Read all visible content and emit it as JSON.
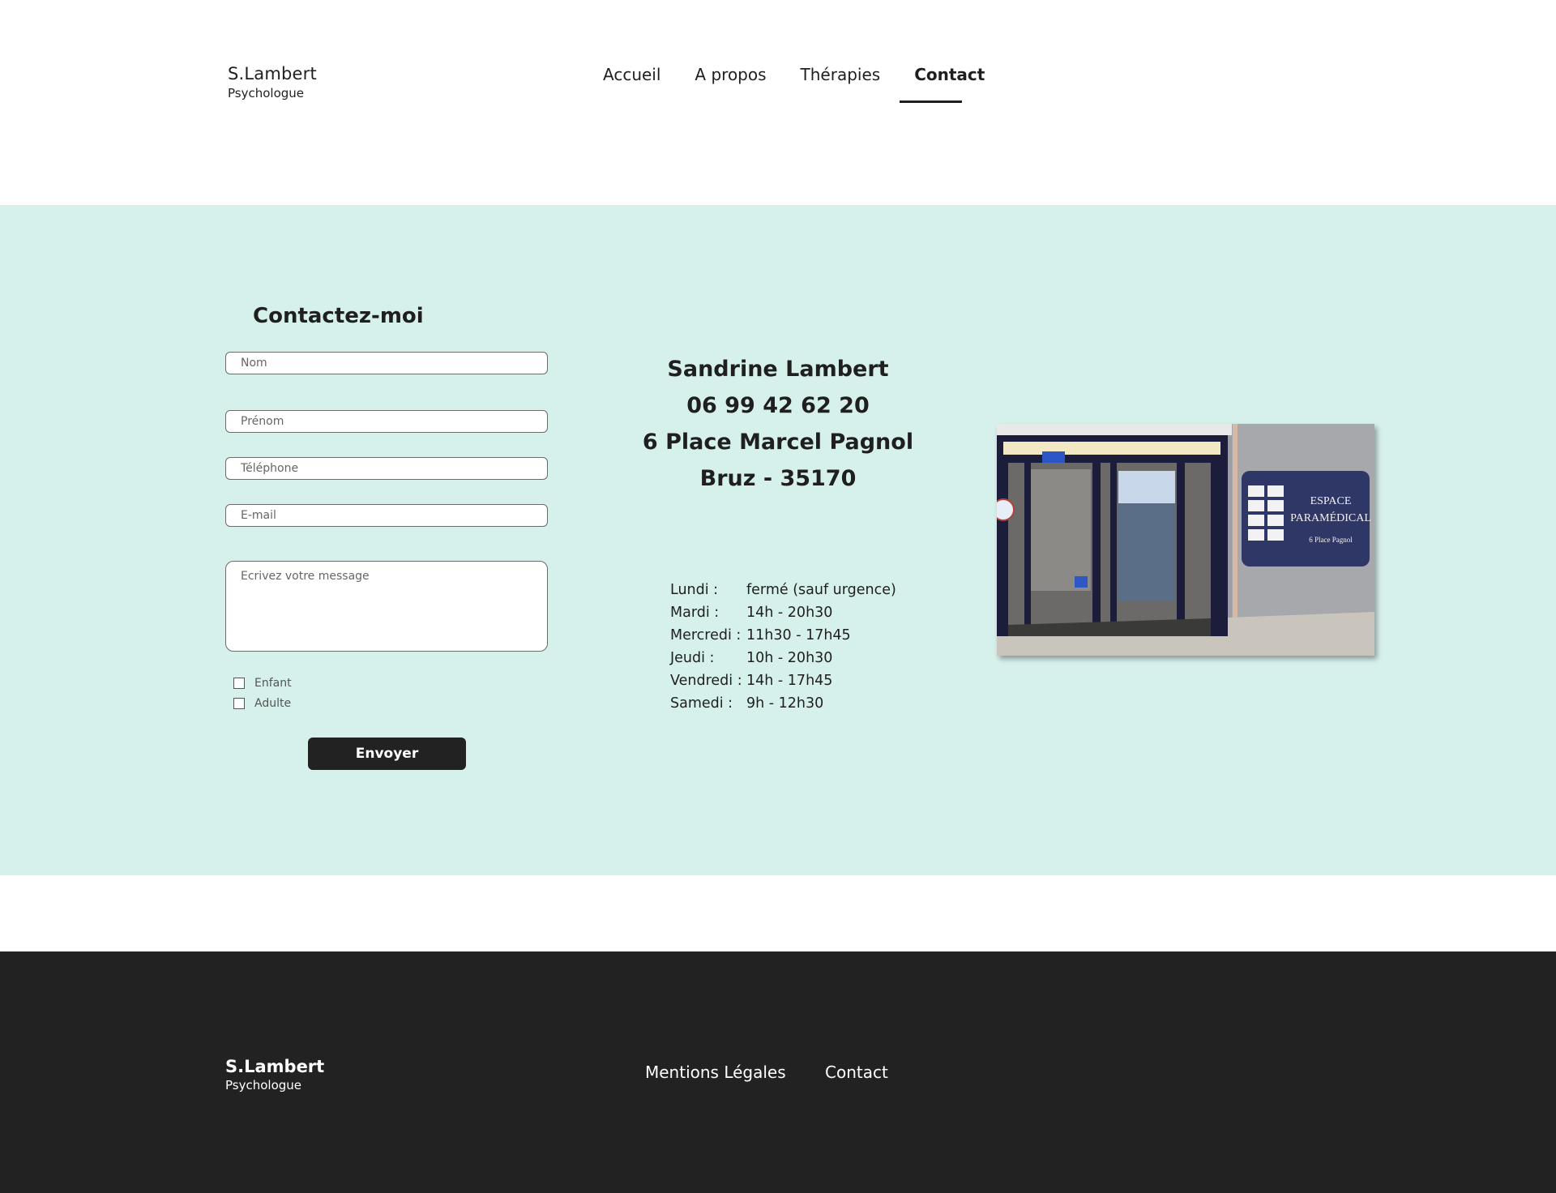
{
  "header": {
    "logo_name": "S.Lambert",
    "logo_subtitle": "Psychologue",
    "nav": [
      {
        "label": "Accueil"
      },
      {
        "label": "A propos"
      },
      {
        "label": "Thérapies"
      },
      {
        "label": "Contact",
        "active": true
      }
    ]
  },
  "contact_form": {
    "title": "Contactez-moi",
    "fields": {
      "nom": {
        "placeholder": "Nom",
        "value": ""
      },
      "prenom": {
        "placeholder": "Prénom",
        "value": ""
      },
      "telephone": {
        "placeholder": "Téléphone",
        "value": ""
      },
      "email": {
        "placeholder": "E-mail",
        "value": ""
      },
      "message": {
        "placeholder": "Ecrivez votre message",
        "value": ""
      }
    },
    "checkboxes": [
      {
        "label": "Enfant",
        "checked": false
      },
      {
        "label": "Adulte",
        "checked": false
      }
    ],
    "submit_label": "Envoyer"
  },
  "info": {
    "name": "Sandrine Lambert",
    "phone": "06 99 42 62 20",
    "street": "6 Place Marcel Pagnol",
    "city": "Bruz - 35170"
  },
  "hours": [
    {
      "day": "Lundi :",
      "time": "fermé (sauf urgence)"
    },
    {
      "day": "Mardi :",
      "time": "14h - 20h30"
    },
    {
      "day": "Mercredi :",
      "time": "11h30 - 17h45"
    },
    {
      "day": "Jeudi :",
      "time": "10h - 20h30"
    },
    {
      "day": "Vendredi :",
      "time": "14h - 17h45"
    },
    {
      "day": "Samedi :",
      "time": "9h - 12h30"
    }
  ],
  "photo": {
    "sign_line1": "ESPACE",
    "sign_line2": "PARAMÉDICAL",
    "sign_line3": "6 Place Pagnol"
  },
  "footer": {
    "logo_name": "S.Lambert",
    "logo_subtitle": "Psychologue",
    "links": [
      {
        "label": "Mentions Légales"
      },
      {
        "label": "Contact"
      }
    ]
  },
  "colors": {
    "band_bg": "#d6f0ec",
    "footer_bg": "#222222",
    "button_bg": "#222222",
    "text": "#1f1f1f"
  }
}
